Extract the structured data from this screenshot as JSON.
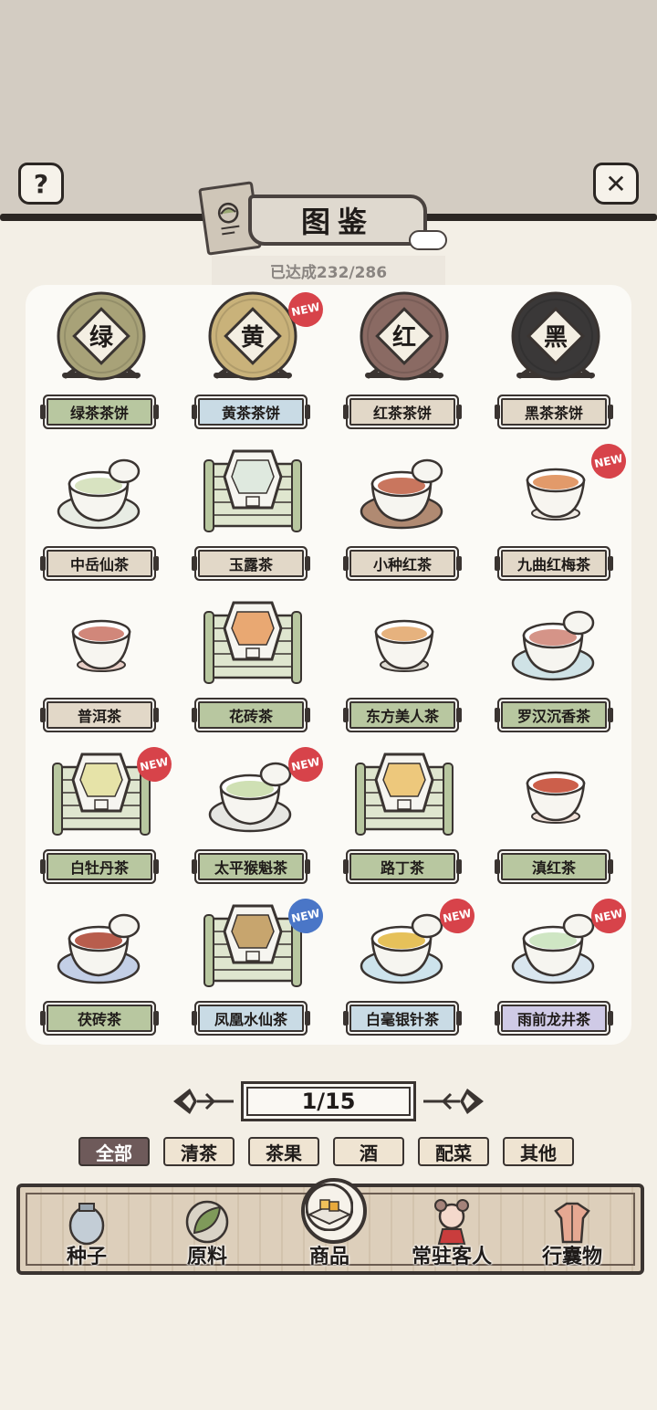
{
  "header": {
    "title": "图鉴",
    "progress_text": "已达成232/286",
    "help_icon": "question-mark-icon",
    "close_icon": "close-x-icon"
  },
  "badge_text": "NEW",
  "items": [
    {
      "name": "绿茶茶饼",
      "plate": "#b8c7a0",
      "art": "cake",
      "cake_color": "#a8a278",
      "cake_char": "绿",
      "badge": null
    },
    {
      "name": "黄茶茶饼",
      "plate": "#c9dbe5",
      "art": "cake",
      "cake_color": "#c9b27a",
      "cake_char": "黄",
      "badge": "red"
    },
    {
      "name": "红茶茶饼",
      "plate": "#e2d8c8",
      "art": "cake",
      "cake_color": "#8a6a63",
      "cake_char": "红",
      "badge": null
    },
    {
      "name": "黑茶茶饼",
      "plate": "#e2d8c8",
      "art": "cake",
      "cake_color": "#3a3838",
      "cake_char": "黑",
      "badge": null
    },
    {
      "name": "中岳仙茶",
      "plate": "#e2d8c8",
      "art": "cup",
      "liquid": "#d8e3c1",
      "saucer": "#e8ece4",
      "badge": null
    },
    {
      "name": "玉露茶",
      "plate": "#e2d8c8",
      "art": "box",
      "liquid": "#dfe9df",
      "badge": null
    },
    {
      "name": "小种红茶",
      "plate": "#e2d8c8",
      "art": "cup",
      "liquid": "#c9765e",
      "saucer": "#b08a72",
      "badge": null
    },
    {
      "name": "九曲红梅茶",
      "plate": "#e2d8c8",
      "art": "bowl",
      "liquid": "#e29a6a",
      "saucer": "#f0ebe4",
      "badge": "red"
    },
    {
      "name": "普洱茶",
      "plate": "#e2d8c8",
      "art": "bowl",
      "liquid": "#d1877a",
      "saucer": "#e8cfc7",
      "badge": null
    },
    {
      "name": "花砖茶",
      "plate": "#b8c7a0",
      "art": "box",
      "liquid": "#e9a872",
      "badge": null
    },
    {
      "name": "东方美人茶",
      "plate": "#b8c7a0",
      "art": "bowl",
      "liquid": "#e6b27e",
      "saucer": "#dedbd3",
      "badge": null
    },
    {
      "name": "罗汉沉香茶",
      "plate": "#b8c7a0",
      "art": "cup",
      "liquid": "#d59488",
      "saucer": "#cfe2e6",
      "badge": null
    },
    {
      "name": "白牡丹茶",
      "plate": "#b8c7a0",
      "art": "box",
      "liquid": "#e6e3a8",
      "badge": "red"
    },
    {
      "name": "太平猴魁茶",
      "plate": "#b8c7a0",
      "art": "cup",
      "liquid": "#cfe0b4",
      "saucer": "#e6e6e2",
      "badge": "red"
    },
    {
      "name": "路丁茶",
      "plate": "#b8c7a0",
      "art": "box",
      "liquid": "#edc87c",
      "badge": null
    },
    {
      "name": "滇红茶",
      "plate": "#b8c7a0",
      "art": "bowl",
      "liquid": "#cc5f4b",
      "saucer": "#f1e2da",
      "badge": null
    },
    {
      "name": "茯砖茶",
      "plate": "#b8c7a0",
      "art": "cup",
      "liquid": "#b85d4d",
      "saucer": "#c3cfe6",
      "badge": null
    },
    {
      "name": "凤凰水仙茶",
      "plate": "#c9dbe5",
      "art": "box",
      "liquid": "#c7a56e",
      "badge": "blue"
    },
    {
      "name": "白毫银针茶",
      "plate": "#c9dbe5",
      "art": "cup",
      "liquid": "#e6c15a",
      "saucer": "#cde3ec",
      "badge": "red"
    },
    {
      "name": "雨前龙井茶",
      "plate": "#cfcae6",
      "art": "cup",
      "liquid": "#cfe6c4",
      "saucer": "#d9e6ef",
      "badge": "red"
    }
  ],
  "pager": {
    "label": "1/15",
    "prev_icon": "arrow-left-icon",
    "next_icon": "arrow-right-icon"
  },
  "filters": [
    {
      "label": "全部",
      "active": true
    },
    {
      "label": "清茶",
      "active": false
    },
    {
      "label": "茶果",
      "active": false
    },
    {
      "label": "酒",
      "active": false
    },
    {
      "label": "配菜",
      "active": false
    },
    {
      "label": "其他",
      "active": false
    }
  ],
  "nav": [
    {
      "label": "种子",
      "icon": "seed-jar-icon"
    },
    {
      "label": "原料",
      "icon": "leaf-icon"
    },
    {
      "label": "商品",
      "icon": "goods-plate-icon"
    },
    {
      "label": "常驻客人",
      "icon": "guest-girl-icon"
    },
    {
      "label": "行囊物",
      "icon": "robe-icon"
    }
  ],
  "colors": {
    "ink": "#2b2623",
    "panel": "#fbfaf6",
    "active_filter": "#6e5a5a",
    "filter_bg": "#efe4d2",
    "badge_red": "#d7434a",
    "badge_blue": "#4a76c7"
  }
}
